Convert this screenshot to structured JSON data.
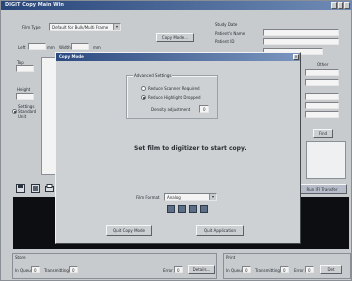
{
  "window": {
    "title": "DIGIT Copy Main Win"
  },
  "top_form": {
    "film_type_label": "Film Type",
    "film_type_value": "Default for Bulk/Multi Frame",
    "copy_mode_button": "Copy Mode...",
    "left_label": "Left",
    "left_unit": "mm",
    "width_label": "Width",
    "width_unit": "mm",
    "top_label": "Top",
    "height_label": "Height",
    "settings_label": "Settings",
    "standard_label": "Standard",
    "unit_label": "Unit",
    "study_date_label": "Study Date",
    "patient_name_label": "Patient's Name",
    "patient_id_label": "Patient ID",
    "other_label": "Other",
    "find_button": "Find"
  },
  "dialog": {
    "title": "Copy Mode",
    "advanced_settings_label": "Advanced Settings",
    "radio_1": "Reduce Scanner Required",
    "radio_2": "Reduce Highlight Dropped",
    "density_label": "Density adjustment",
    "density_value": "0",
    "message": "Set film to digitizer to start copy.",
    "film_format_label": "Film Format",
    "film_format_value": "Analog",
    "quit_copy_mode_button": "Quit Copy Mode",
    "quit_application_button": "Quit Application"
  },
  "right_panel": {
    "more_button": "Run IFI Transfer"
  },
  "status_left": {
    "section_label": "Store",
    "in_queue_label": "In Queue",
    "in_queue_value": "0",
    "transmitting_label": "Transmitting",
    "transmitting_value": "0",
    "error_label": "Error",
    "error_value": "0",
    "details_button": "Details..."
  },
  "status_right": {
    "section_label": "Print",
    "in_queue_label": "In Queue",
    "in_queue_value": "0",
    "transmitting_label": "Transmitting",
    "transmitting_value": "0",
    "error_label": "Error",
    "error_value": "0",
    "more_button": "Det"
  },
  "colors": {
    "titlebar": "#28457a",
    "window_bg": "#c7cbce",
    "viewer": "#0c0e12"
  },
  "icons": [
    "save-icon",
    "image-icon",
    "print-icon"
  ]
}
